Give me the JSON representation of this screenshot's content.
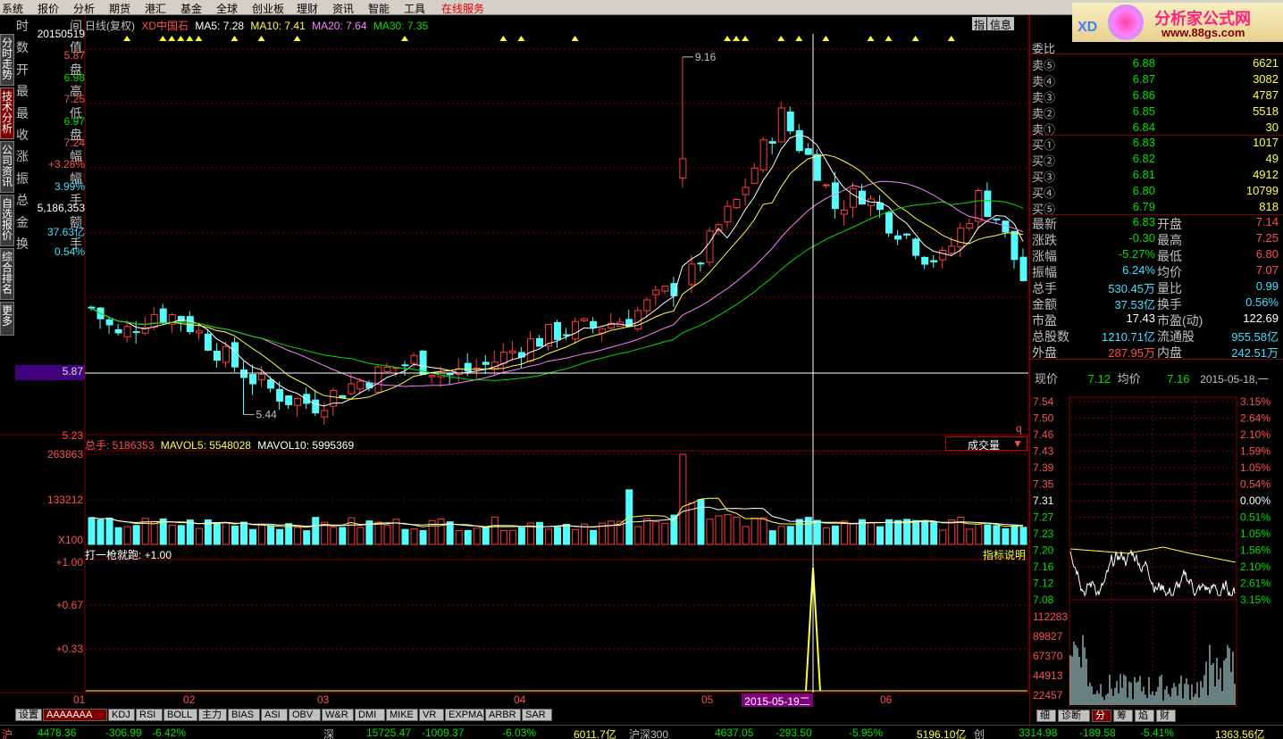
{
  "menu": [
    "系统",
    "报价",
    "分析",
    "期货",
    "港汇",
    "基金",
    "全球",
    "创业板",
    "理财",
    "资讯",
    "智能",
    "工具",
    "在线服务"
  ],
  "left_tabs": [
    "分时走势",
    "技术分析",
    "公司资讯",
    "自选报价",
    "综合排名",
    "更多"
  ],
  "info": {
    "rows": [
      {
        "a": "时",
        "b": "间",
        "v": "20150519"
      },
      {
        "a": "数",
        "b": "值",
        "v": "5.87"
      },
      {
        "a": "开",
        "b": "盘",
        "v": "6.98"
      },
      {
        "a": "最",
        "b": "高",
        "v": "7.25"
      },
      {
        "a": "最",
        "b": "低",
        "v": "6.97"
      },
      {
        "a": "收",
        "b": "盘",
        "v": "7.24"
      },
      {
        "a": "涨",
        "b": "幅",
        "v": "+3.28%"
      },
      {
        "a": "振",
        "b": "幅",
        "v": "3.99%"
      },
      {
        "a": "总",
        "b": "手",
        "v": "5,186,353"
      },
      {
        "a": "金",
        "b": "额",
        "v": "37.63亿"
      },
      {
        "a": "换",
        "b": "手",
        "v": "0.54%"
      }
    ],
    "cursor_value": "5.87"
  },
  "chart_header": {
    "period": "日线(复权)",
    "name": "XD中国石",
    "ma5": "MA5: 7.28",
    "ma10": "MA10: 7.41",
    "ma20": "MA20: 7.64",
    "ma30": "MA30: 7.35",
    "btn1": "指",
    "btn2": "信息"
  },
  "price_axis": {
    "low_label": "5.23",
    "cursor_label": "5.87",
    "max_label": "9.16",
    "min_label": "5.44",
    "q": "q"
  },
  "vol_header": {
    "total": "总手: 5186353",
    "mavol5": "MAVOL5: 5548028",
    "mavol10": "MAVOL10: 5995369",
    "dropdown": "成交量",
    "axis_top": "263863",
    "axis_mid": "133212",
    "axis_unit": "X100"
  },
  "ind_header": {
    "title": "打一枪就跑: +1.00",
    "explain": "指标说明",
    "y1": "+1.00",
    "y2": "+0.67",
    "y3": "+0.33"
  },
  "date_axis": {
    "labels": [
      "01",
      "02",
      "03",
      "04",
      "05",
      "06"
    ],
    "cursor": "2015-05-19二"
  },
  "bottom_tabs": [
    "设置",
    "AAAAAAA",
    "KDJ",
    "RSI",
    "BOLL",
    "主力",
    "BIAS",
    "ASI",
    "OBV",
    "W&R",
    "DMI",
    "MIKE",
    "VR",
    "EXPMA",
    "ARBR",
    "SAR"
  ],
  "logo": {
    "title": "分析家公式网",
    "url": "www.88gs.com",
    "xd": "XD"
  },
  "orderbook": {
    "weibi": "委比",
    "asks": [
      {
        "l": "卖⑤",
        "p": "6.88",
        "v": "6621"
      },
      {
        "l": "卖④",
        "p": "6.87",
        "v": "3082"
      },
      {
        "l": "卖③",
        "p": "6.86",
        "v": "4787"
      },
      {
        "l": "卖②",
        "p": "6.85",
        "v": "5518"
      },
      {
        "l": "卖①",
        "p": "6.84",
        "v": "30"
      }
    ],
    "bids": [
      {
        "l": "买①",
        "p": "6.83",
        "v": "1017"
      },
      {
        "l": "买②",
        "p": "6.82",
        "v": "49"
      },
      {
        "l": "买③",
        "p": "6.81",
        "v": "4912"
      },
      {
        "l": "买④",
        "p": "6.80",
        "v": "10799"
      },
      {
        "l": "买⑤",
        "p": "6.79",
        "v": "818"
      }
    ],
    "stats": [
      {
        "l1": "最新",
        "v1": "6.83",
        "l2": "开盘",
        "v2": "7.14"
      },
      {
        "l1": "涨跌",
        "v1": "-0.30",
        "l2": "最高",
        "v2": "7.25"
      },
      {
        "l1": "涨幅",
        "v1": "-5.27%",
        "l2": "最低",
        "v2": "6.80"
      },
      {
        "l1": "振幅",
        "v1": "6.24%",
        "l2": "均价",
        "v2": "7.07"
      },
      {
        "l1": "总手",
        "v1": "530.45万",
        "l2": "量比",
        "v2": "0.99"
      },
      {
        "l1": "金额",
        "v1": "37.53亿",
        "l2": "换手",
        "v2": "0.56%"
      },
      {
        "l1": "市盈",
        "v1": "17.43",
        "l2": "市盈(动)",
        "v2": "122.69"
      },
      {
        "l1": "总股数",
        "v1": "1210.71亿",
        "l2": "流通股",
        "v2": "955.58亿"
      },
      {
        "l1": "外盘",
        "v1": "287.95万",
        "l2": "内盘",
        "v2": "242.51万"
      }
    ]
  },
  "mini": {
    "now_l": "现价",
    "now_v": "7.12",
    "avg_l": "均价",
    "avg_v": "7.16",
    "date": "2015-05-18,一",
    "prices": [
      "7.54",
      "7.50",
      "7.46",
      "7.43",
      "7.39",
      "7.35",
      "7.31",
      "7.27",
      "7.23",
      "7.20",
      "7.16",
      "7.12",
      "7.08"
    ],
    "pcts": [
      "3.15%",
      "2.64%",
      "2.10%",
      "1.59%",
      "1.05%",
      "0.54%",
      "0.00%",
      "0.51%",
      "1.05%",
      "1.56%",
      "2.10%",
      "2.61%",
      "3.15%"
    ],
    "vols": [
      "112283",
      "89827",
      "67370",
      "44913",
      "22457"
    ],
    "tabs": [
      "细",
      "诊断",
      "分",
      "筹",
      "焰",
      "财"
    ]
  },
  "status": [
    {
      "t": "沪",
      "c": "#ff5050"
    },
    {
      "t": "4478.36",
      "c": "#00e000"
    },
    {
      "t": "-306.99",
      "c": "#00e000"
    },
    {
      "t": "-6.42%",
      "c": "#00e000"
    },
    {
      "t": "深",
      "c": "#c0c0c0"
    },
    {
      "t": "15725.47",
      "c": "#00e000"
    },
    {
      "t": "-1009.37",
      "c": "#00e000"
    },
    {
      "t": "-6.03%",
      "c": "#00e000"
    },
    {
      "t": "6011.7亿",
      "c": "#ffff40"
    },
    {
      "t": "沪深300",
      "c": "#c0c0c0"
    },
    {
      "t": "4637.05",
      "c": "#00e000"
    },
    {
      "t": "-293.50",
      "c": "#00e000"
    },
    {
      "t": "-5.95%",
      "c": "#00e000"
    },
    {
      "t": "5196.10亿",
      "c": "#ffff40"
    },
    {
      "t": "创",
      "c": "#c0c0c0"
    },
    {
      "t": "3314.98",
      "c": "#00e000"
    },
    {
      "t": "-189.58",
      "c": "#00e000"
    },
    {
      "t": "-5.41%",
      "c": "#00e000"
    },
    {
      "t": "1363.56亿",
      "c": "#ffff40"
    }
  ],
  "colors": {
    "up": "#ff3c3c",
    "down": "#54fcfc",
    "ma5": "#ffffff",
    "ma10": "#ffff40",
    "ma20": "#ff80ff",
    "ma30": "#00e000",
    "grid": "#800000"
  }
}
